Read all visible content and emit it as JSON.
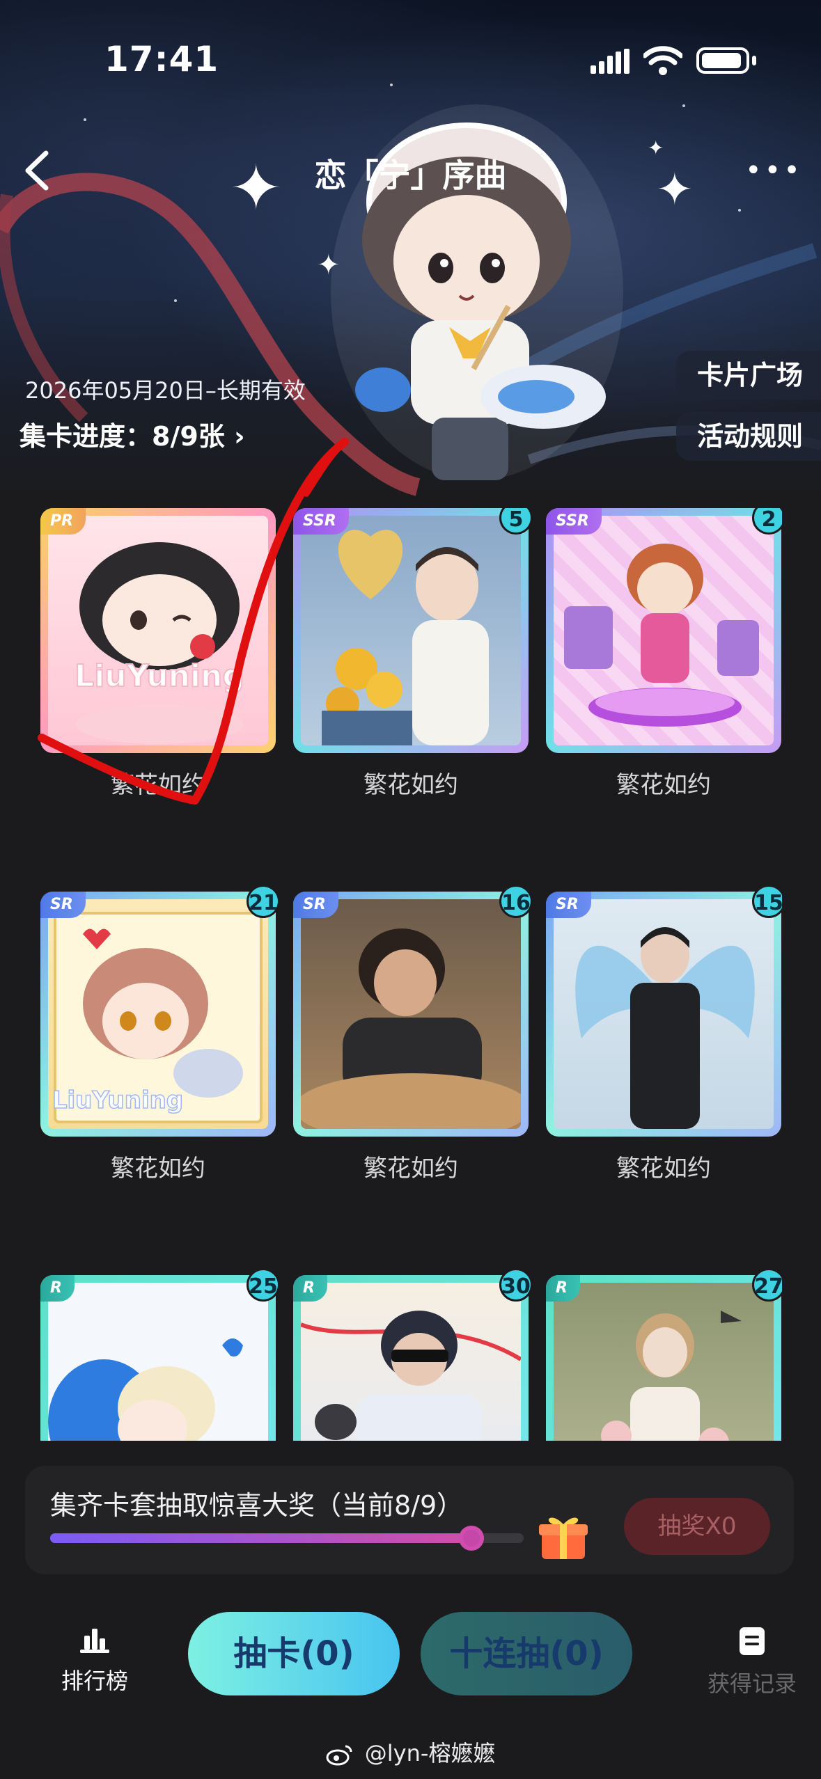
{
  "status_bar": {
    "time": "17:41"
  },
  "header": {
    "title": "恋「宁」序曲"
  },
  "event": {
    "validity": "2026年05月20日–长期有效",
    "progress_label": "集卡进度：8/9张",
    "progress_chevron": "›"
  },
  "side_buttons": {
    "plaza": "卡片广场",
    "rules": "活动规则"
  },
  "cards": [
    {
      "rarity": "PR",
      "count": "",
      "name": "繁花如约"
    },
    {
      "rarity": "SSR",
      "count": "5",
      "name": "繁花如约"
    },
    {
      "rarity": "SSR",
      "count": "2",
      "name": "繁花如约"
    },
    {
      "rarity": "SR",
      "count": "21",
      "name": "繁花如约"
    },
    {
      "rarity": "SR",
      "count": "16",
      "name": "繁花如约"
    },
    {
      "rarity": "SR",
      "count": "15",
      "name": "繁花如约"
    },
    {
      "rarity": "R",
      "count": "25",
      "name": ""
    },
    {
      "rarity": "R",
      "count": "30",
      "name": ""
    },
    {
      "rarity": "R",
      "count": "27",
      "name": ""
    }
  ],
  "card_overlay_text": "LiuYuning",
  "collect": {
    "title": "集齐卡套抽取惊喜大奖（当前8/9）",
    "progress": 0.889,
    "draw_button": "抽奖X0"
  },
  "bottom_bar": {
    "rank_label": "排行榜",
    "draw_label": "抽卡(0)",
    "ten_draw_label": "十连抽(0)",
    "record_label": "获得记录"
  },
  "watermark": "@lyn-榕嬷嬷",
  "colors": {
    "background": "#1b1b1d",
    "accent_cyan": "#3fd2e2",
    "progress_start": "#7b5cf5",
    "progress_end": "#d14ea8",
    "annotation_red": "#e01010"
  },
  "icons": {
    "back": "chevron-left-icon",
    "more": "more-dots-icon",
    "rank": "bar-chart-icon",
    "record": "document-icon",
    "gift": "gift-box-icon",
    "watermark": "weibo-icon"
  }
}
